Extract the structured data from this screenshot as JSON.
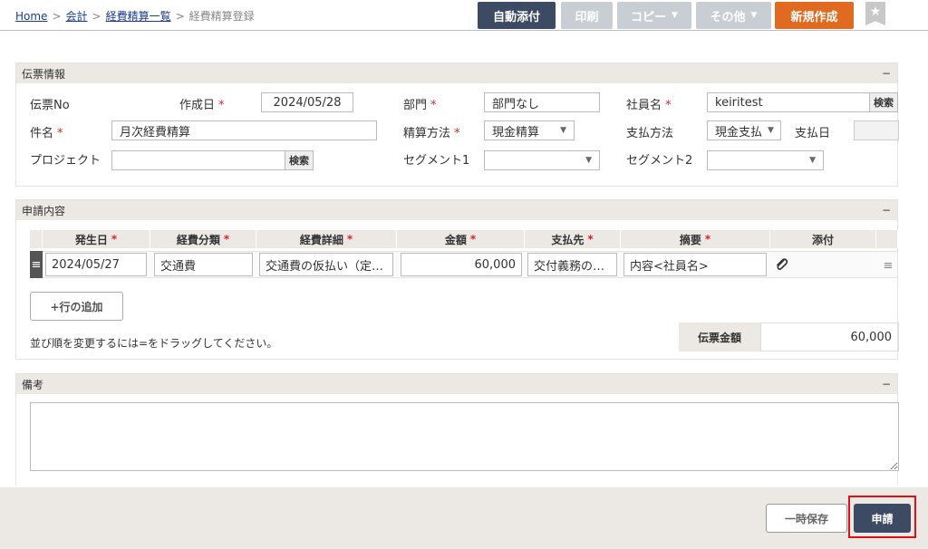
{
  "breadcrumb": {
    "home": "Home",
    "accounting": "会計",
    "list": "経費精算一覧",
    "current": "経費精算登録",
    "separator": ">"
  },
  "toolbar": {
    "auto_attach": "自動添付",
    "print": "印刷",
    "copy": "コピー",
    "other": "その他",
    "new": "新規作成"
  },
  "voucher": {
    "title": "伝票情報",
    "collapse": "−",
    "voucher_no_label": "伝票No",
    "created_label": "作成日",
    "created_value": "2024/05/28",
    "department_label": "部門",
    "department_value": "部門なし",
    "employee_label": "社員名",
    "employee_value": "keiritest",
    "search": "検索",
    "subject_label": "件名",
    "subject_value": "月次経費精算",
    "settlement_label": "精算方法",
    "settlement_value": "現金精算",
    "payment_method_label": "支払方法",
    "payment_method_value": "現金支払",
    "payment_date_label": "支払日",
    "project_label": "プロジェクト",
    "segment1_label": "セグメント1",
    "segment2_label": "セグメント2",
    "required_mark": "*"
  },
  "details": {
    "title": "申請内容",
    "collapse": "−",
    "headers": {
      "date": "発生日",
      "category": "経費分類",
      "detail": "経費詳細",
      "amount": "金額",
      "payee": "支払先",
      "summary": "摘要",
      "attachment": "添付"
    },
    "row": {
      "handle": "≡",
      "date": "2024/05/27",
      "category": "交通費",
      "detail": "交通費の仮払い（定…",
      "amount": "60,000",
      "payee": "交付義務の…",
      "summary": "内容<社員名>",
      "menu": "≡"
    },
    "add_row": "+行の追加",
    "drag_hint": "並び順を変更するには=をドラッグしてください。",
    "total_label": "伝票金額",
    "total_value": "60,000"
  },
  "remarks": {
    "title": "備考",
    "collapse": "−"
  },
  "footer": {
    "save": "一時保存",
    "apply": "申請"
  }
}
